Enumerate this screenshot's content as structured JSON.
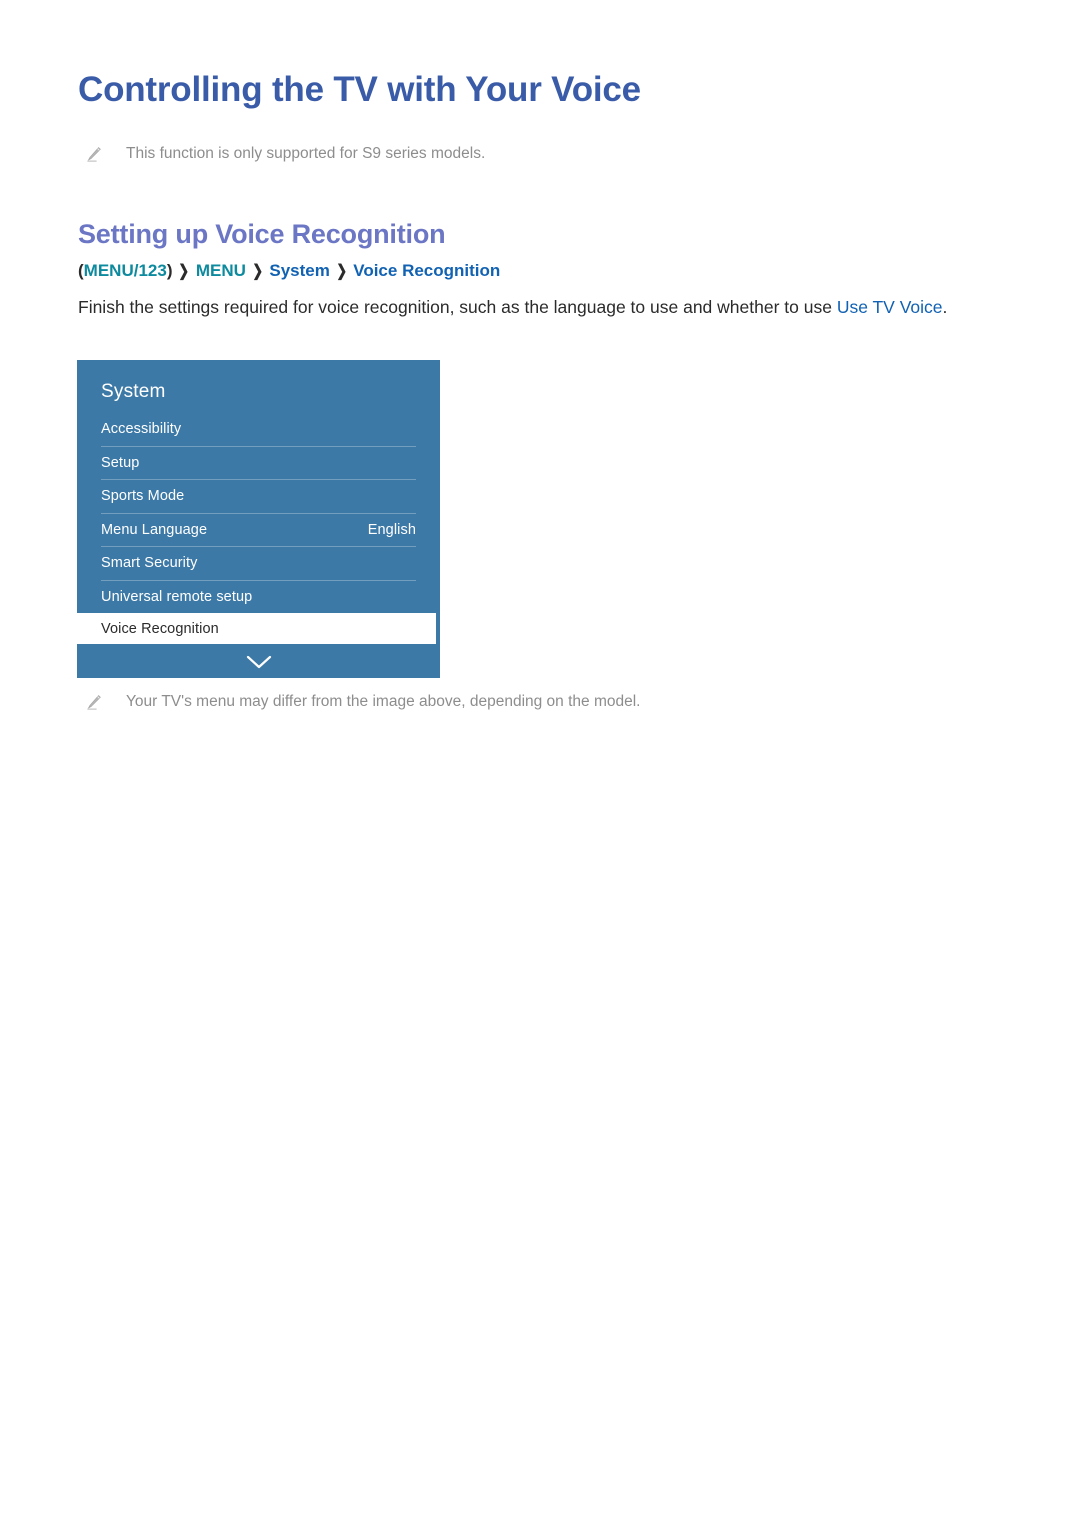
{
  "document": {
    "title": "Controlling the TV with Your Voice",
    "section_title": "Setting up Voice Recognition",
    "accent_title_color": "#3a5ca8",
    "accent_section_color": "#6b76c4",
    "link_color": "#1262b3",
    "breadcrumb_teal_color": "#0d8a9e",
    "note_color": "#8d8d8d"
  },
  "notes": [
    {
      "icon": "pencil-icon",
      "text": "This function is only supported for S9 series models."
    },
    {
      "icon": "pencil-icon",
      "text": "Your TV's menu may differ from the image above, depending on the model."
    }
  ],
  "breadcrumb": {
    "open_paren": "(",
    "close_paren": ")",
    "separator": "❯",
    "items": [
      {
        "label": "MENU/123",
        "style": "teal"
      },
      {
        "label": "MENU",
        "style": "teal"
      },
      {
        "label": "System",
        "style": "blue"
      },
      {
        "label": "Voice Recognition",
        "style": "blue"
      }
    ]
  },
  "body": {
    "text_before": "Finish the settings required for voice recognition, such as the language to use and whether to use ",
    "highlight": "Use TV Voice",
    "text_after": "."
  },
  "tv_menu": {
    "panel_color": "#3d79a6",
    "title": "System",
    "chevron_icon": "chevron-down-icon",
    "items": [
      {
        "label": "Accessibility",
        "value": "",
        "selected": false
      },
      {
        "label": "Setup",
        "value": "",
        "selected": false
      },
      {
        "label": "Sports Mode",
        "value": "",
        "selected": false
      },
      {
        "label": "Menu Language",
        "value": "English",
        "selected": false
      },
      {
        "label": "Smart Security",
        "value": "",
        "selected": false
      },
      {
        "label": "Universal remote setup",
        "value": "",
        "selected": false
      },
      {
        "label": "Voice Recognition",
        "value": "",
        "selected": true
      }
    ]
  }
}
